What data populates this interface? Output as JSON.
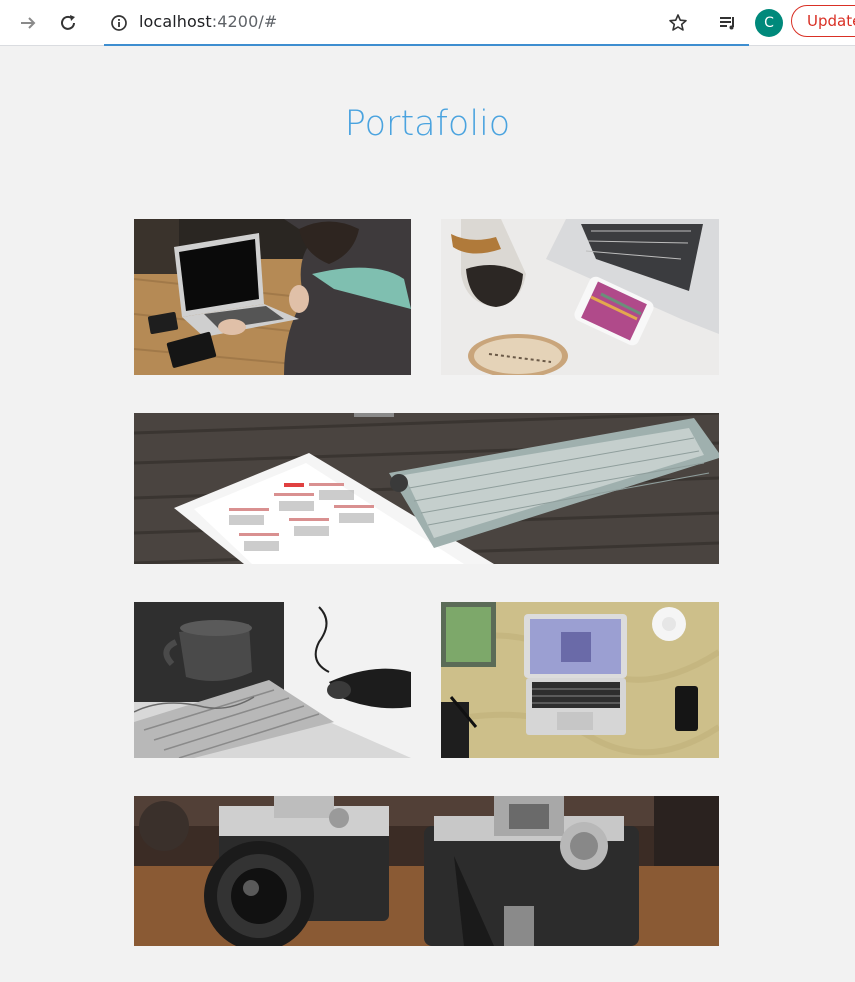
{
  "browser": {
    "url_host": "localhost",
    "url_rest": ":4200/#",
    "profile_initial": "C",
    "update_label": "Update",
    "icons": [
      "forward-arrow-icon",
      "reload-icon",
      "info-icon",
      "star-icon",
      "reading-list-icon"
    ]
  },
  "page": {
    "title": "Portafolio",
    "photos": [
      {
        "name": "laptop-on-desk-photo",
        "alt": "person using laptop on wooden table"
      },
      {
        "name": "laptop-phone-coffee-photo",
        "alt": "laptop, phone and chemex on white desk"
      },
      {
        "name": "tablet-keyboard-photo",
        "alt": "tablet with calendar and keyboard on wood"
      },
      {
        "name": "keyboard-mug-photo",
        "alt": "black and white keyboard, mug and hand"
      },
      {
        "name": "laptop-top-view-photo",
        "alt": "laptop seen from above on marble desk"
      },
      {
        "name": "vintage-cameras-photo",
        "alt": "two vintage cameras on table"
      }
    ]
  },
  "colors": {
    "title": "#4aa3df",
    "background": "#f2f2f2",
    "avatar": "#00897b",
    "update": "#d93025"
  }
}
